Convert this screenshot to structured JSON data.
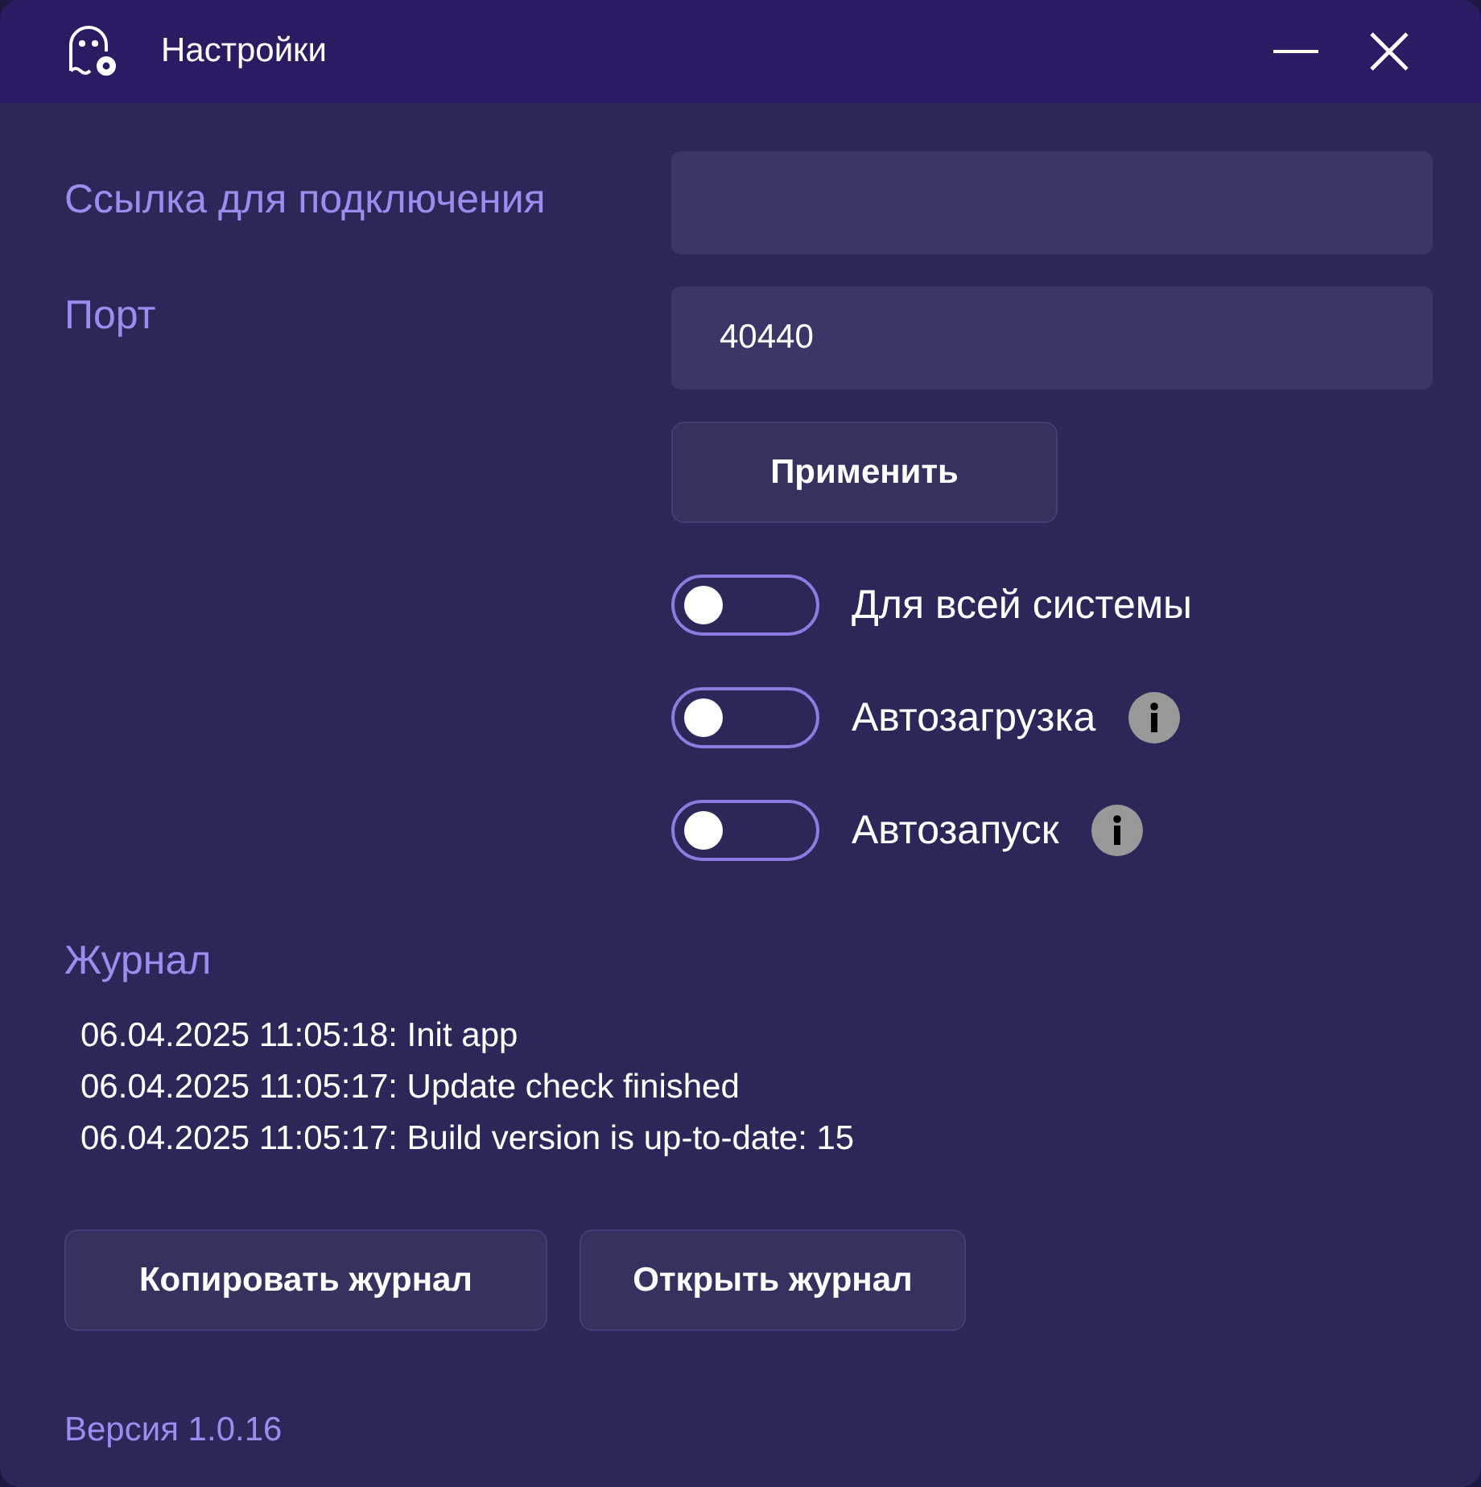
{
  "window": {
    "title": "Настройки"
  },
  "fields": [
    {
      "label": "Ссылка для подключения"
    },
    {
      "label": "Порт",
      "value": "40440"
    }
  ],
  "apply_button": "Применить",
  "toggles": [
    {
      "label": "Для всей системы",
      "on": false,
      "kind": "plain"
    },
    {
      "label": "Автозагрузка",
      "on": false,
      "kind": "with-info"
    },
    {
      "label": "Автозапуск",
      "on": false,
      "kind": "with-info"
    }
  ],
  "log": {
    "title": "Журнал",
    "lines": [
      "06.04.2025 11:05:18: Init app",
      "06.04.2025 11:05:17: Update check finished",
      "06.04.2025 11:05:17: Build version is up-to-date: 15"
    ]
  },
  "log_buttons": [
    "Копировать журнал",
    "Открыть журнал"
  ],
  "version": "Версия 1.0.16"
}
